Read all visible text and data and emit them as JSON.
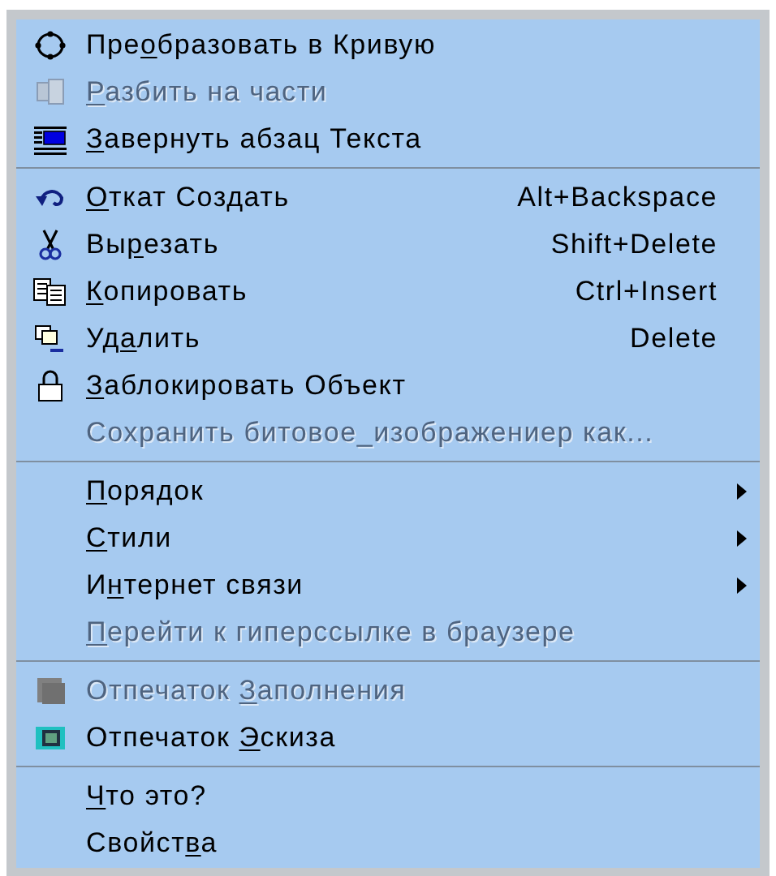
{
  "menu": {
    "items": [
      {
        "kind": "item",
        "before": "Пре",
        "accel": "о",
        "after": "бразовать в Кривую",
        "disabled": false
      },
      {
        "kind": "item",
        "accel": "Р",
        "after": "азбить  на части",
        "disabled": true
      },
      {
        "kind": "item",
        "accel": "З",
        "after": "авернуть абзац Текста",
        "disabled": false
      },
      {
        "kind": "separator"
      },
      {
        "kind": "item",
        "accel": "О",
        "after": "ткат Создать",
        "shortcut": "Alt+Backspace",
        "disabled": false
      },
      {
        "kind": "item",
        "before": "Вы",
        "accel": "р",
        "after": "езать",
        "shortcut": "Shift+Delete",
        "disabled": false
      },
      {
        "kind": "item",
        "accel": "К",
        "after": "опировать",
        "shortcut": "Ctrl+Insert",
        "disabled": false
      },
      {
        "kind": "item",
        "before": "Уд",
        "accel": "а",
        "after": "лить",
        "shortcut": "Delete",
        "disabled": false
      },
      {
        "kind": "item",
        "accel": "З",
        "after": "аблокировать Объект",
        "disabled": false
      },
      {
        "kind": "item",
        "before": "Сохранить битовое_изображениер как...",
        "disabled": true
      },
      {
        "kind": "separator"
      },
      {
        "kind": "item",
        "accel": "П",
        "after": "орядок",
        "submenu": true,
        "disabled": false
      },
      {
        "kind": "item",
        "accel": "С",
        "after": "тили",
        "submenu": true,
        "disabled": false
      },
      {
        "kind": "item",
        "before": "И",
        "accel": "н",
        "after": "тернет связи",
        "submenu": true,
        "disabled": false
      },
      {
        "kind": "item",
        "accel": "П",
        "after": "ерейти к гиперссылке в браузере",
        "disabled": true
      },
      {
        "kind": "separator"
      },
      {
        "kind": "item",
        "before": "Отпечаток ",
        "accel": "З",
        "after": "аполнения",
        "disabled": true
      },
      {
        "kind": "item",
        "before": "Отпечаток ",
        "accel": "Э",
        "after": "скиза",
        "disabled": false
      },
      {
        "kind": "separator"
      },
      {
        "kind": "item",
        "accel": "Ч",
        "after": "то это?",
        "disabled": false
      },
      {
        "kind": "item",
        "before": "Свойст",
        "accel": "в",
        "after": "а",
        "disabled": false
      }
    ]
  }
}
